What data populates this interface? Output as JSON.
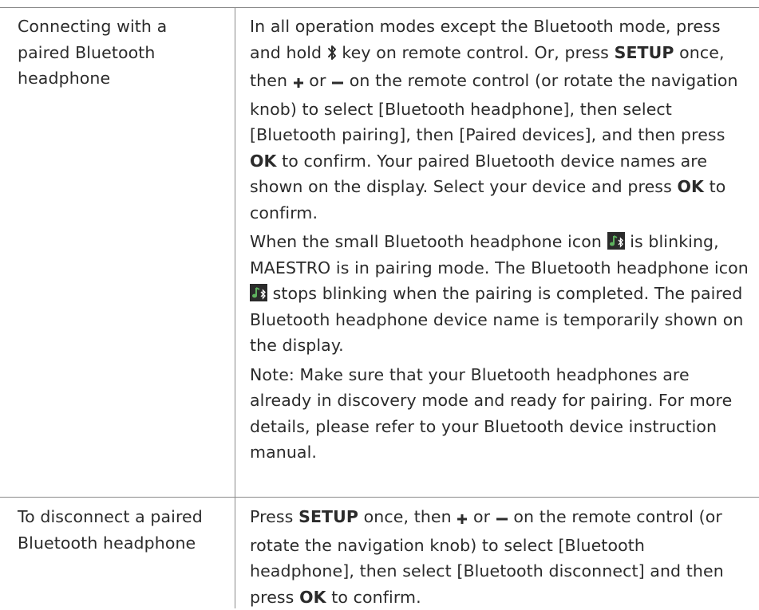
{
  "table": {
    "rows": [
      {
        "label": "Connecting with a paired Bluetooth headphone",
        "label_lines": [
          "Connecting with a",
          "paired Bluetooth",
          "headphone"
        ],
        "paragraphs": {
          "p1": {
            "a": "In all operation modes except the Bluetooth mode, press and hold",
            "b": "key on remote control. Or, press",
            "setup": "SETUP",
            "c": "once, then",
            "d": "or",
            "e": "on the remote control (or rotate the navigation knob) to select [Bluetooth headphone], then select [Bluetooth pairing], then [Paired devices], and then press",
            "ok": "OK",
            "f": "to confirm. Your paired Bluetooth device names are shown on the display. Select your device and press",
            "ok2": "OK",
            "g": "to confirm."
          },
          "p2": {
            "a": "When the small Bluetooth headphone icon",
            "b": "is blinking, MAESTRO is in pairing mode. The Bluetooth headphone icon",
            "c": "stops blinking when the pairing is completed. The paired Bluetooth headphone device name is temporarily shown on the display."
          },
          "p3": "Note: Make sure that your Bluetooth headphones are already in discovery mode and ready for pairing. For more details, please refer to your Bluetooth device instruction manual."
        }
      },
      {
        "label": "To disconnect a paired Bluetooth headphone",
        "label_lines": [
          "To disconnect a paired",
          "Bluetooth headphone"
        ],
        "paragraphs": {
          "p1": {
            "a": "Press",
            "setup": "SETUP",
            "b": "once, then",
            "c": "or",
            "d": "on the remote control (or rotate the navigation knob) to select [Bluetooth headphone], then select [Bluetooth disconnect] and then press",
            "ok": "OK",
            "e": "to confirm."
          }
        }
      }
    ]
  },
  "icons": {
    "bluetooth_key": "bluetooth-icon",
    "plus_key": "plus-icon",
    "minus_key": "minus-icon",
    "bt_headphone": "bluetooth-headphone-icon",
    "icon_colors": {
      "background": "#2b2b2b",
      "note": "#5fb35f"
    }
  }
}
